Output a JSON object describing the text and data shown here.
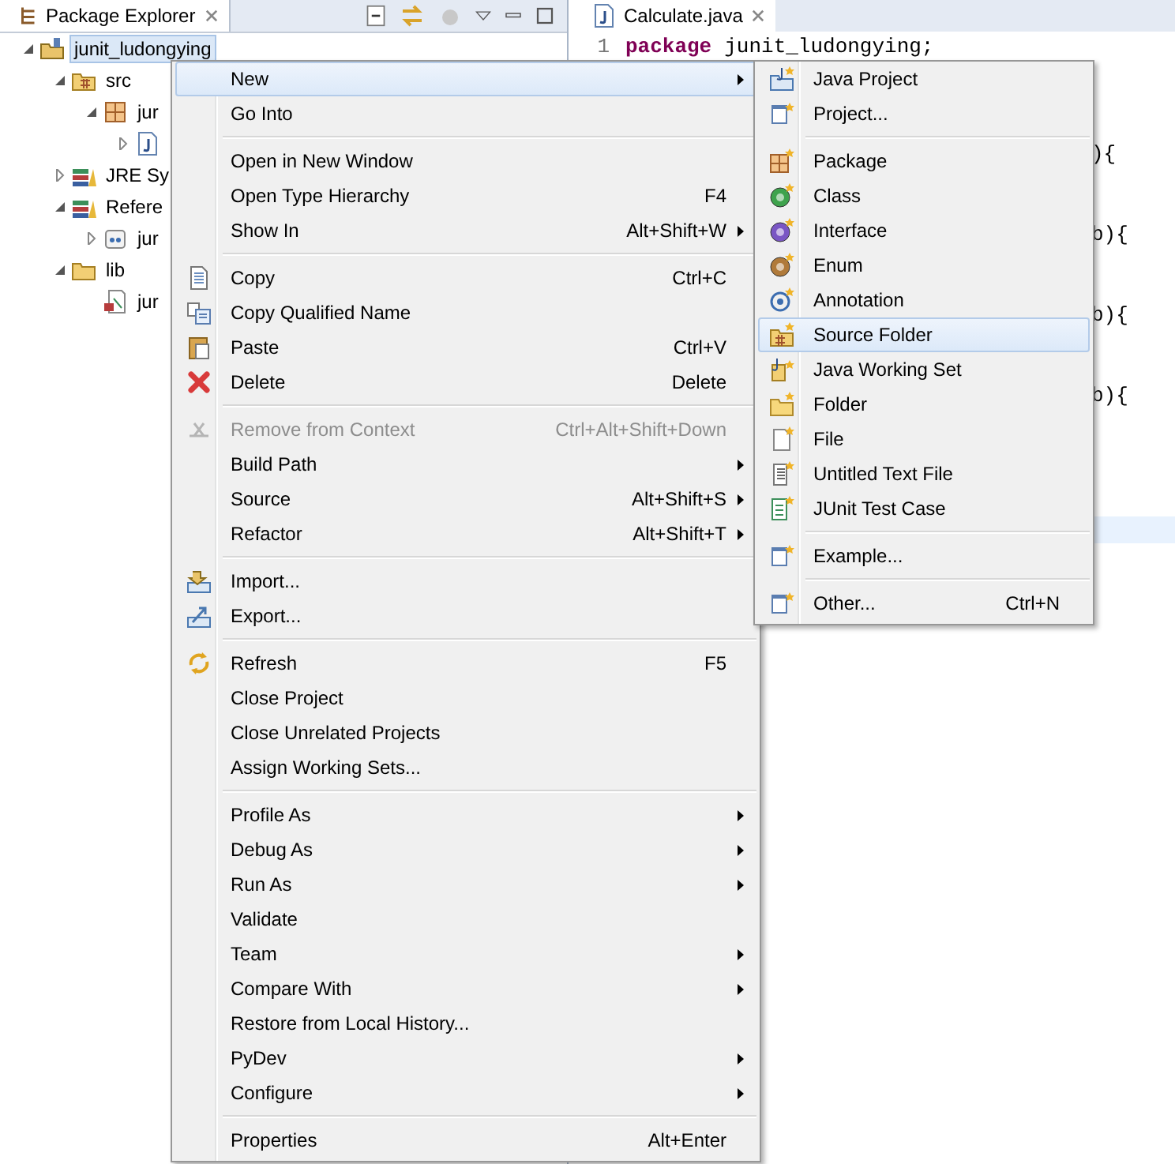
{
  "package_explorer": {
    "title": "Package Explorer",
    "tree": [
      {
        "label": "junit_ludongying",
        "kind": "project",
        "expanded": true,
        "selected": true,
        "children": [
          {
            "label": "src",
            "kind": "source-folder",
            "expanded": true,
            "selected": false,
            "children": [
              {
                "label": "jur",
                "kind": "package",
                "expanded": true,
                "selected": false,
                "children": [
                  {
                    "kind": "java-file",
                    "expanded": false
                  }
                ]
              }
            ]
          },
          {
            "label": "JRE Sy",
            "kind": "library",
            "expanded": false,
            "selected": false
          },
          {
            "label": "Refere",
            "kind": "library",
            "expanded": true,
            "selected": false,
            "children": [
              {
                "label": "jur",
                "kind": "jar",
                "expanded": false,
                "selected": false
              }
            ]
          },
          {
            "label": "lib",
            "kind": "folder",
            "expanded": true,
            "selected": false,
            "children": [
              {
                "label": "jur",
                "kind": "jar-file",
                "selected": false
              }
            ]
          }
        ]
      }
    ]
  },
  "editor": {
    "tab": "Calculate.java",
    "lines": [
      {
        "kind": "code",
        "number": "1",
        "keyword": "package",
        "text": "junit_ludongying;",
        "current": false
      },
      {
        "kind": "blank",
        "current": false
      },
      {
        "kind": "blank",
        "current": false
      },
      {
        "kind": "blank",
        "current": false
      },
      {
        "kind": "tail",
        "text": "){",
        "current": false
      },
      {
        "kind": "blank",
        "current": false
      },
      {
        "kind": "blank",
        "current": false
      },
      {
        "kind": "tail",
        "text": "b){",
        "current": false
      },
      {
        "kind": "blank",
        "current": false
      },
      {
        "kind": "blank",
        "current": false
      },
      {
        "kind": "tail",
        "text": "b){",
        "current": false
      },
      {
        "kind": "blank",
        "current": false
      },
      {
        "kind": "blank",
        "current": false
      },
      {
        "kind": "tail",
        "text": "b){",
        "current": false
      },
      {
        "kind": "blank",
        "current": false
      },
      {
        "kind": "blank",
        "current": false
      },
      {
        "kind": "blank",
        "current": false
      },
      {
        "kind": "blank",
        "current": false
      },
      {
        "kind": "blank",
        "current": true
      }
    ]
  },
  "context_menu": {
    "items": [
      {
        "kind": "item",
        "label": "New",
        "submenu": true,
        "disabled": false,
        "selected": true
      },
      {
        "kind": "item",
        "label": "Go Into",
        "disabled": false,
        "selected": false
      },
      {
        "kind": "separator"
      },
      {
        "kind": "item",
        "label": "Open in New Window",
        "disabled": false,
        "selected": false
      },
      {
        "kind": "item",
        "label": "Open Type Hierarchy",
        "shortcut": "F4",
        "disabled": false,
        "selected": false
      },
      {
        "kind": "item",
        "label": "Show In",
        "shortcut": "Alt+Shift+W",
        "submenu": true,
        "disabled": false,
        "selected": false
      },
      {
        "kind": "separator"
      },
      {
        "kind": "item",
        "label": "Copy",
        "shortcut": "Ctrl+C",
        "disabled": false,
        "selected": false
      },
      {
        "kind": "item",
        "label": "Copy Qualified Name",
        "disabled": false,
        "selected": false
      },
      {
        "kind": "item",
        "label": "Paste",
        "shortcut": "Ctrl+V",
        "disabled": false,
        "selected": false
      },
      {
        "kind": "item",
        "label": "Delete",
        "shortcut": "Delete",
        "disabled": false,
        "selected": false
      },
      {
        "kind": "separator"
      },
      {
        "kind": "item",
        "label": "Remove from Context",
        "shortcut": "Ctrl+Alt+Shift+Down",
        "disabled": true,
        "selected": false
      },
      {
        "kind": "item",
        "label": "Build Path",
        "submenu": true,
        "disabled": false,
        "selected": false
      },
      {
        "kind": "item",
        "label": "Source",
        "shortcut": "Alt+Shift+S",
        "submenu": true,
        "disabled": false,
        "selected": false
      },
      {
        "kind": "item",
        "label": "Refactor",
        "shortcut": "Alt+Shift+T",
        "submenu": true,
        "disabled": false,
        "selected": false
      },
      {
        "kind": "separator"
      },
      {
        "kind": "item",
        "label": "Import...",
        "disabled": false,
        "selected": false
      },
      {
        "kind": "item",
        "label": "Export...",
        "disabled": false,
        "selected": false
      },
      {
        "kind": "separator"
      },
      {
        "kind": "item",
        "label": "Refresh",
        "shortcut": "F5",
        "disabled": false,
        "selected": false
      },
      {
        "kind": "item",
        "label": "Close Project",
        "disabled": false,
        "selected": false
      },
      {
        "kind": "item",
        "label": "Close Unrelated Projects",
        "disabled": false,
        "selected": false
      },
      {
        "kind": "item",
        "label": "Assign Working Sets...",
        "disabled": false,
        "selected": false
      },
      {
        "kind": "separator"
      },
      {
        "kind": "item",
        "label": "Profile As",
        "submenu": true,
        "disabled": false,
        "selected": false
      },
      {
        "kind": "item",
        "label": "Debug As",
        "submenu": true,
        "disabled": false,
        "selected": false
      },
      {
        "kind": "item",
        "label": "Run As",
        "submenu": true,
        "disabled": false,
        "selected": false
      },
      {
        "kind": "item",
        "label": "Validate",
        "disabled": false,
        "selected": false
      },
      {
        "kind": "item",
        "label": "Team",
        "submenu": true,
        "disabled": false,
        "selected": false
      },
      {
        "kind": "item",
        "label": "Compare With",
        "submenu": true,
        "disabled": false,
        "selected": false
      },
      {
        "kind": "item",
        "label": "Restore from Local History...",
        "disabled": false,
        "selected": false
      },
      {
        "kind": "item",
        "label": "PyDev",
        "submenu": true,
        "disabled": false,
        "selected": false
      },
      {
        "kind": "item",
        "label": "Configure",
        "submenu": true,
        "disabled": false,
        "selected": false
      },
      {
        "kind": "separator"
      },
      {
        "kind": "item",
        "label": "Properties",
        "shortcut": "Alt+Enter",
        "disabled": false,
        "selected": false
      }
    ]
  },
  "new_submenu": {
    "items": [
      {
        "kind": "item",
        "label": "Java Project",
        "selected": false
      },
      {
        "kind": "item",
        "label": "Project...",
        "selected": false
      },
      {
        "kind": "separator"
      },
      {
        "kind": "item",
        "label": "Package",
        "selected": false
      },
      {
        "kind": "item",
        "label": "Class",
        "selected": false
      },
      {
        "kind": "item",
        "label": "Interface",
        "selected": false
      },
      {
        "kind": "item",
        "label": "Enum",
        "selected": false
      },
      {
        "kind": "item",
        "label": "Annotation",
        "selected": false
      },
      {
        "kind": "item",
        "label": "Source Folder",
        "selected": true
      },
      {
        "kind": "item",
        "label": "Java Working Set",
        "selected": false
      },
      {
        "kind": "item",
        "label": "Folder",
        "selected": false
      },
      {
        "kind": "item",
        "label": "File",
        "selected": false
      },
      {
        "kind": "item",
        "label": "Untitled Text File",
        "selected": false
      },
      {
        "kind": "item",
        "label": "JUnit Test Case",
        "selected": false
      },
      {
        "kind": "separator"
      },
      {
        "kind": "item",
        "label": "Example...",
        "selected": false
      },
      {
        "kind": "separator"
      },
      {
        "kind": "item",
        "label": "Other...",
        "shortcut": "Ctrl+N",
        "selected": false
      }
    ]
  }
}
